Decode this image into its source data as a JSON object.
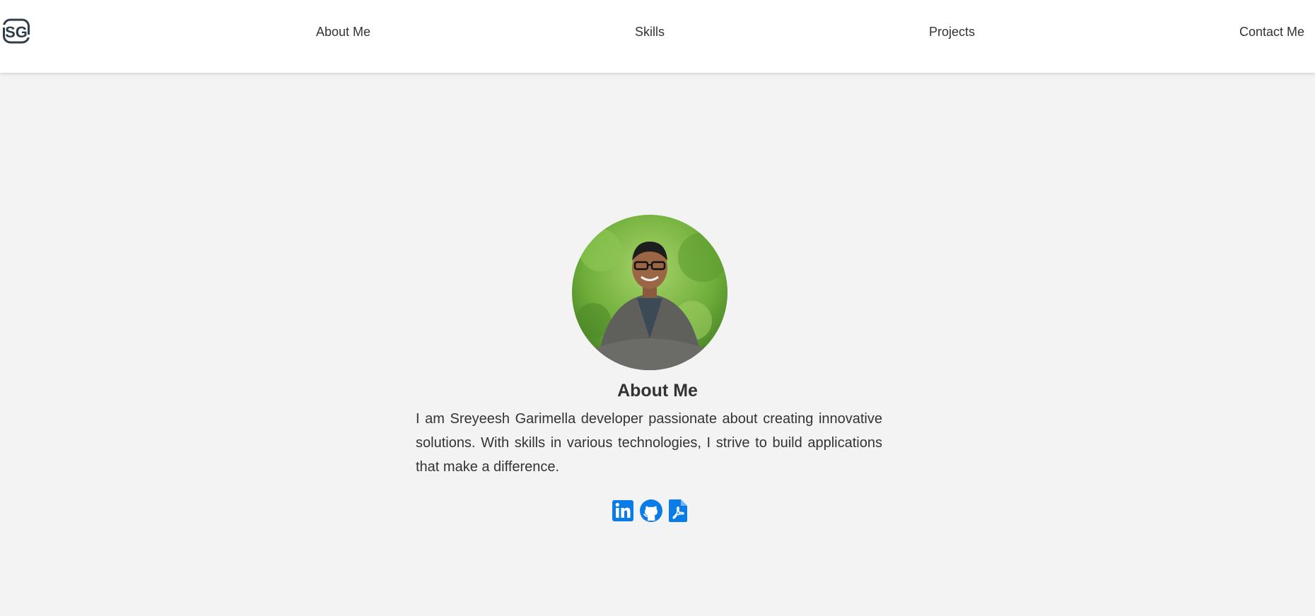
{
  "logo": {
    "text": "SG",
    "icon": "sg-logo-icon"
  },
  "nav": {
    "items": [
      {
        "label": "About Me"
      },
      {
        "label": "Skills"
      },
      {
        "label": "Projects"
      },
      {
        "label": "Contact Me"
      }
    ]
  },
  "about": {
    "title": "About Me",
    "text": "I am Sreyeesh Garimella developer passionate about creating innovative solutions. With skills in various technologies, I strive to build applications that make a difference.",
    "avatar_icon": "profile-photo"
  },
  "social": [
    {
      "icon": "linkedin-icon"
    },
    {
      "icon": "github-icon"
    },
    {
      "icon": "pdf-resume-icon"
    }
  ],
  "colors": {
    "accent": "#0a7ce8",
    "text": "#333333",
    "background": "#f3f3f3",
    "navbar": "#ffffff",
    "logo": "#2f3e48"
  }
}
